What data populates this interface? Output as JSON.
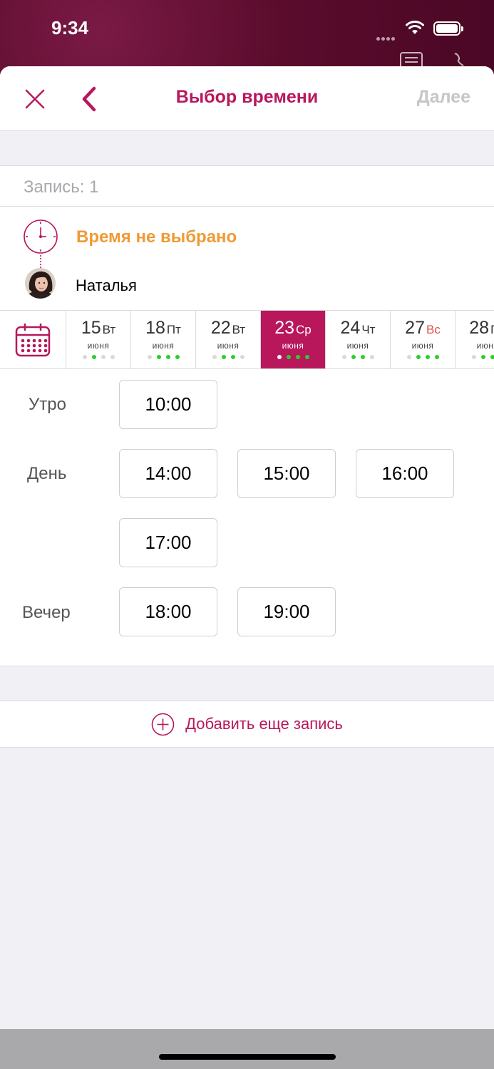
{
  "status_bar": {
    "time": "9:34"
  },
  "nav": {
    "title": "Выбор времени",
    "next_label": "Далее"
  },
  "record": {
    "label": "Запись: 1",
    "time_status": "Время не выбрано",
    "specialist": "Наталья"
  },
  "dates": [
    {
      "day": "15",
      "weekday": "Вт",
      "month": "июня",
      "weekend": false,
      "selected": false,
      "dots": [
        false,
        true,
        false,
        false
      ]
    },
    {
      "day": "18",
      "weekday": "Пт",
      "month": "июня",
      "weekend": false,
      "selected": false,
      "dots": [
        false,
        true,
        true,
        true
      ]
    },
    {
      "day": "22",
      "weekday": "Вт",
      "month": "июня",
      "weekend": false,
      "selected": false,
      "dots": [
        false,
        true,
        true,
        false
      ]
    },
    {
      "day": "23",
      "weekday": "Ср",
      "month": "июня",
      "weekend": false,
      "selected": true,
      "dots": [
        false,
        true,
        true,
        true
      ]
    },
    {
      "day": "24",
      "weekday": "Чт",
      "month": "июня",
      "weekend": false,
      "selected": false,
      "dots": [
        false,
        true,
        true,
        false
      ]
    },
    {
      "day": "27",
      "weekday": "Вс",
      "month": "июня",
      "weekend": true,
      "selected": false,
      "dots": [
        false,
        true,
        true,
        true
      ]
    },
    {
      "day": "28",
      "weekday": "Пн",
      "month": "июня",
      "weekend": false,
      "selected": false,
      "dots": [
        false,
        true,
        true,
        true
      ]
    }
  ],
  "periods": {
    "morning": "Утро",
    "day": "День",
    "evening": "Вечер"
  },
  "slots": {
    "morning": [
      "10:00"
    ],
    "day": [
      "14:00",
      "15:00",
      "16:00",
      "17:00"
    ],
    "evening": [
      "18:00",
      "19:00"
    ]
  },
  "add_record_label": "Добавить еще запись",
  "colors": {
    "accent": "#b8175c",
    "warning": "#ef9a34",
    "available_dot": "#2ad02a",
    "weekend": "#e0504e"
  }
}
